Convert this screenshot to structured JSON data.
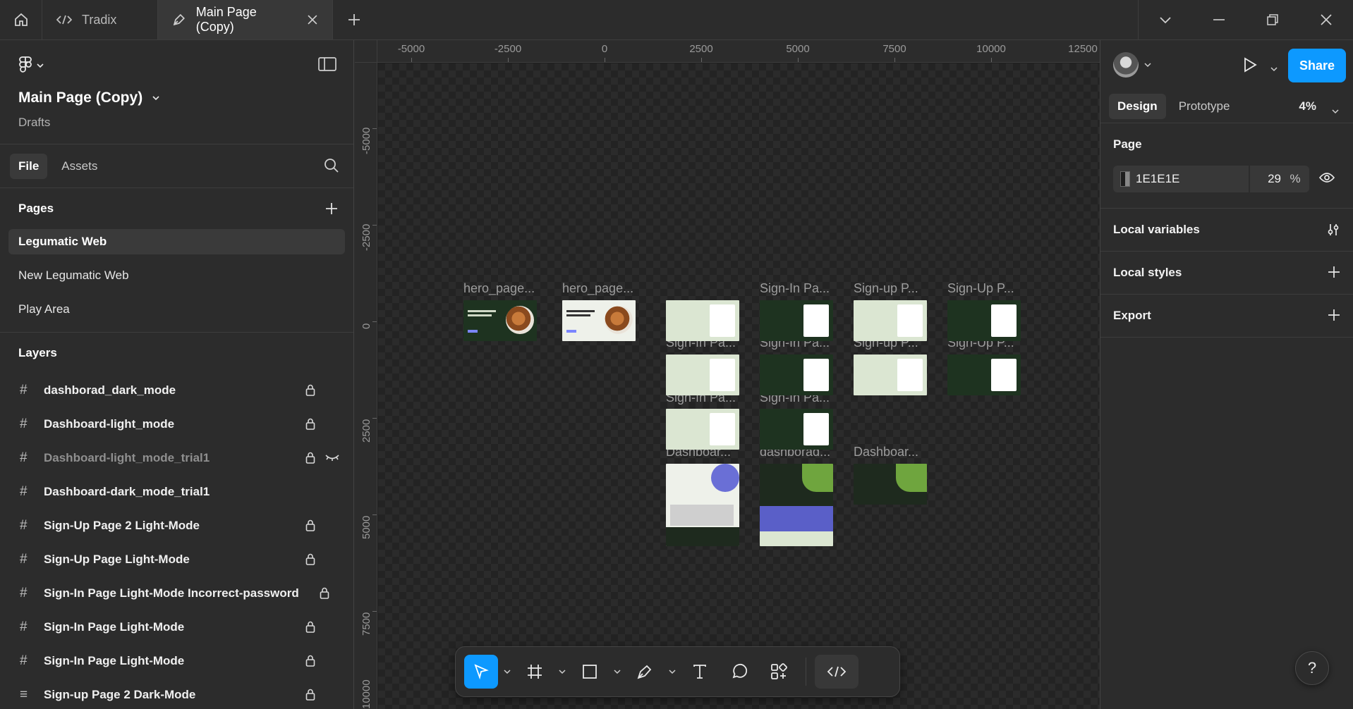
{
  "titlebar": {
    "tabs": [
      {
        "label": "Tradix"
      },
      {
        "label": "Main Page (Copy)"
      }
    ]
  },
  "left_panel": {
    "project_title": "Main Page (Copy)",
    "project_location": "Drafts",
    "tabs": [
      "File",
      "Assets"
    ],
    "pages_heading": "Pages",
    "pages": [
      "Legumatic Web",
      "New Legumatic Web",
      "Play Area"
    ],
    "layers_heading": "Layers",
    "layers": [
      {
        "name": "dashborad_dark_mode",
        "locked": true
      },
      {
        "name": "Dashboard-light_mode",
        "locked": true
      },
      {
        "name": "Dashboard-light_mode_trial1",
        "locked": true,
        "hidden": true
      },
      {
        "name": "Dashboard-dark_mode_trial1",
        "locked": false
      },
      {
        "name": "Sign-Up Page 2 Light-Mode",
        "locked": true
      },
      {
        "name": "Sign-Up Page Light-Mode",
        "locked": true
      },
      {
        "name": "Sign-In Page Light-Mode Incorrect-password",
        "locked": true
      },
      {
        "name": "Sign-In Page Light-Mode",
        "locked": true
      },
      {
        "name": "Sign-In Page Light-Mode",
        "locked": true
      },
      {
        "name": "Sign-up Page 2 Dark-Mode",
        "locked": true
      }
    ]
  },
  "canvas": {
    "ruler_x": [
      "-5000",
      "-2500",
      "0",
      "2500",
      "5000",
      "7500",
      "10000",
      "12500"
    ],
    "ruler_y": [
      "-5000",
      "-2500",
      "0",
      "2500",
      "5000",
      "7500",
      "10000"
    ],
    "frame_labels": [
      "hero_page...",
      "hero_page...",
      "Sign-In Pa...",
      "Sign-up P...",
      "Sign-Up P...",
      "Sign-In Pa...",
      "Sign-In Pa...",
      "Sign-up P...",
      "Sign-Up P...",
      "Sign-In Pa...",
      "Sign-In Pa...",
      "Dashboar...",
      "dashborad...",
      "Dashboar..."
    ]
  },
  "right_panel": {
    "share_label": "Share",
    "tabs": [
      "Design",
      "Prototype"
    ],
    "zoom": "4%",
    "page_heading": "Page",
    "page_color_hex": "1E1E1E",
    "page_opacity": "29",
    "page_opacity_unit": "%",
    "local_variables": "Local variables",
    "local_styles": "Local styles",
    "export": "Export"
  },
  "help_label": "?",
  "colors": {
    "accent": "#0d99ff",
    "panel": "#2c2c2c",
    "canvas": "#1e1e1e"
  }
}
